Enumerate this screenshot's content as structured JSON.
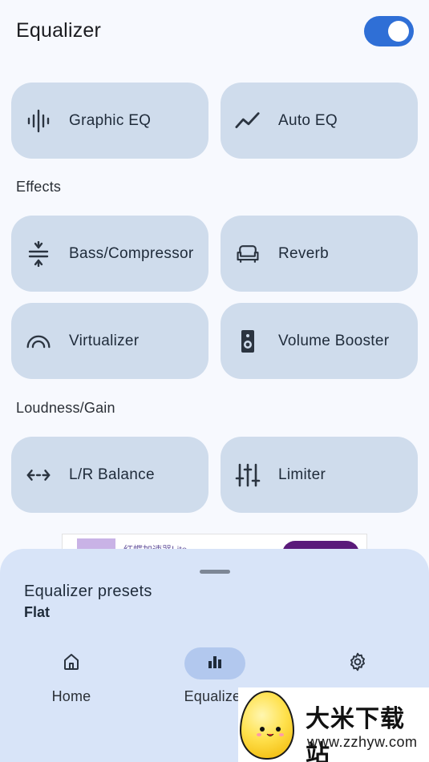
{
  "header": {
    "title": "Equalizer",
    "enabled": true
  },
  "main": {
    "top_tiles": [
      {
        "label": "Graphic EQ",
        "icon": "waveform-icon"
      },
      {
        "label": "Auto EQ",
        "icon": "trend-line-icon"
      }
    ],
    "effects": {
      "heading": "Effects",
      "tiles": [
        {
          "label": "Bass/Compressor",
          "icon": "compress-icon"
        },
        {
          "label": "Reverb",
          "icon": "sofa-icon"
        },
        {
          "label": "Virtualizer",
          "icon": "arc-icon"
        },
        {
          "label": "Volume Booster",
          "icon": "speaker-icon"
        }
      ]
    },
    "loudness": {
      "heading": "Loudness/Gain",
      "tiles": [
        {
          "label": "L/R Balance",
          "icon": "left-right-arrows-icon"
        },
        {
          "label": "Limiter",
          "icon": "sliders-icon"
        }
      ]
    }
  },
  "ad": {
    "text": "红蝶加速器Lite"
  },
  "sheet": {
    "preset_label": "Equalizer presets",
    "preset_value": "Flat"
  },
  "nav": {
    "items": [
      {
        "label": "Home",
        "icon": "home-icon",
        "active": false
      },
      {
        "label": "Equalizer",
        "icon": "bar-chart-icon",
        "active": true
      },
      {
        "label": "",
        "icon": "gear-icon",
        "active": false
      }
    ]
  },
  "watermark": {
    "title": "大米下载站",
    "url": "www.zzhyw.com"
  },
  "colors": {
    "accent": "#2f6fd6",
    "tile": "#cfdcec",
    "sheet": "#d8e4f8",
    "background": "#f7f9fe"
  }
}
